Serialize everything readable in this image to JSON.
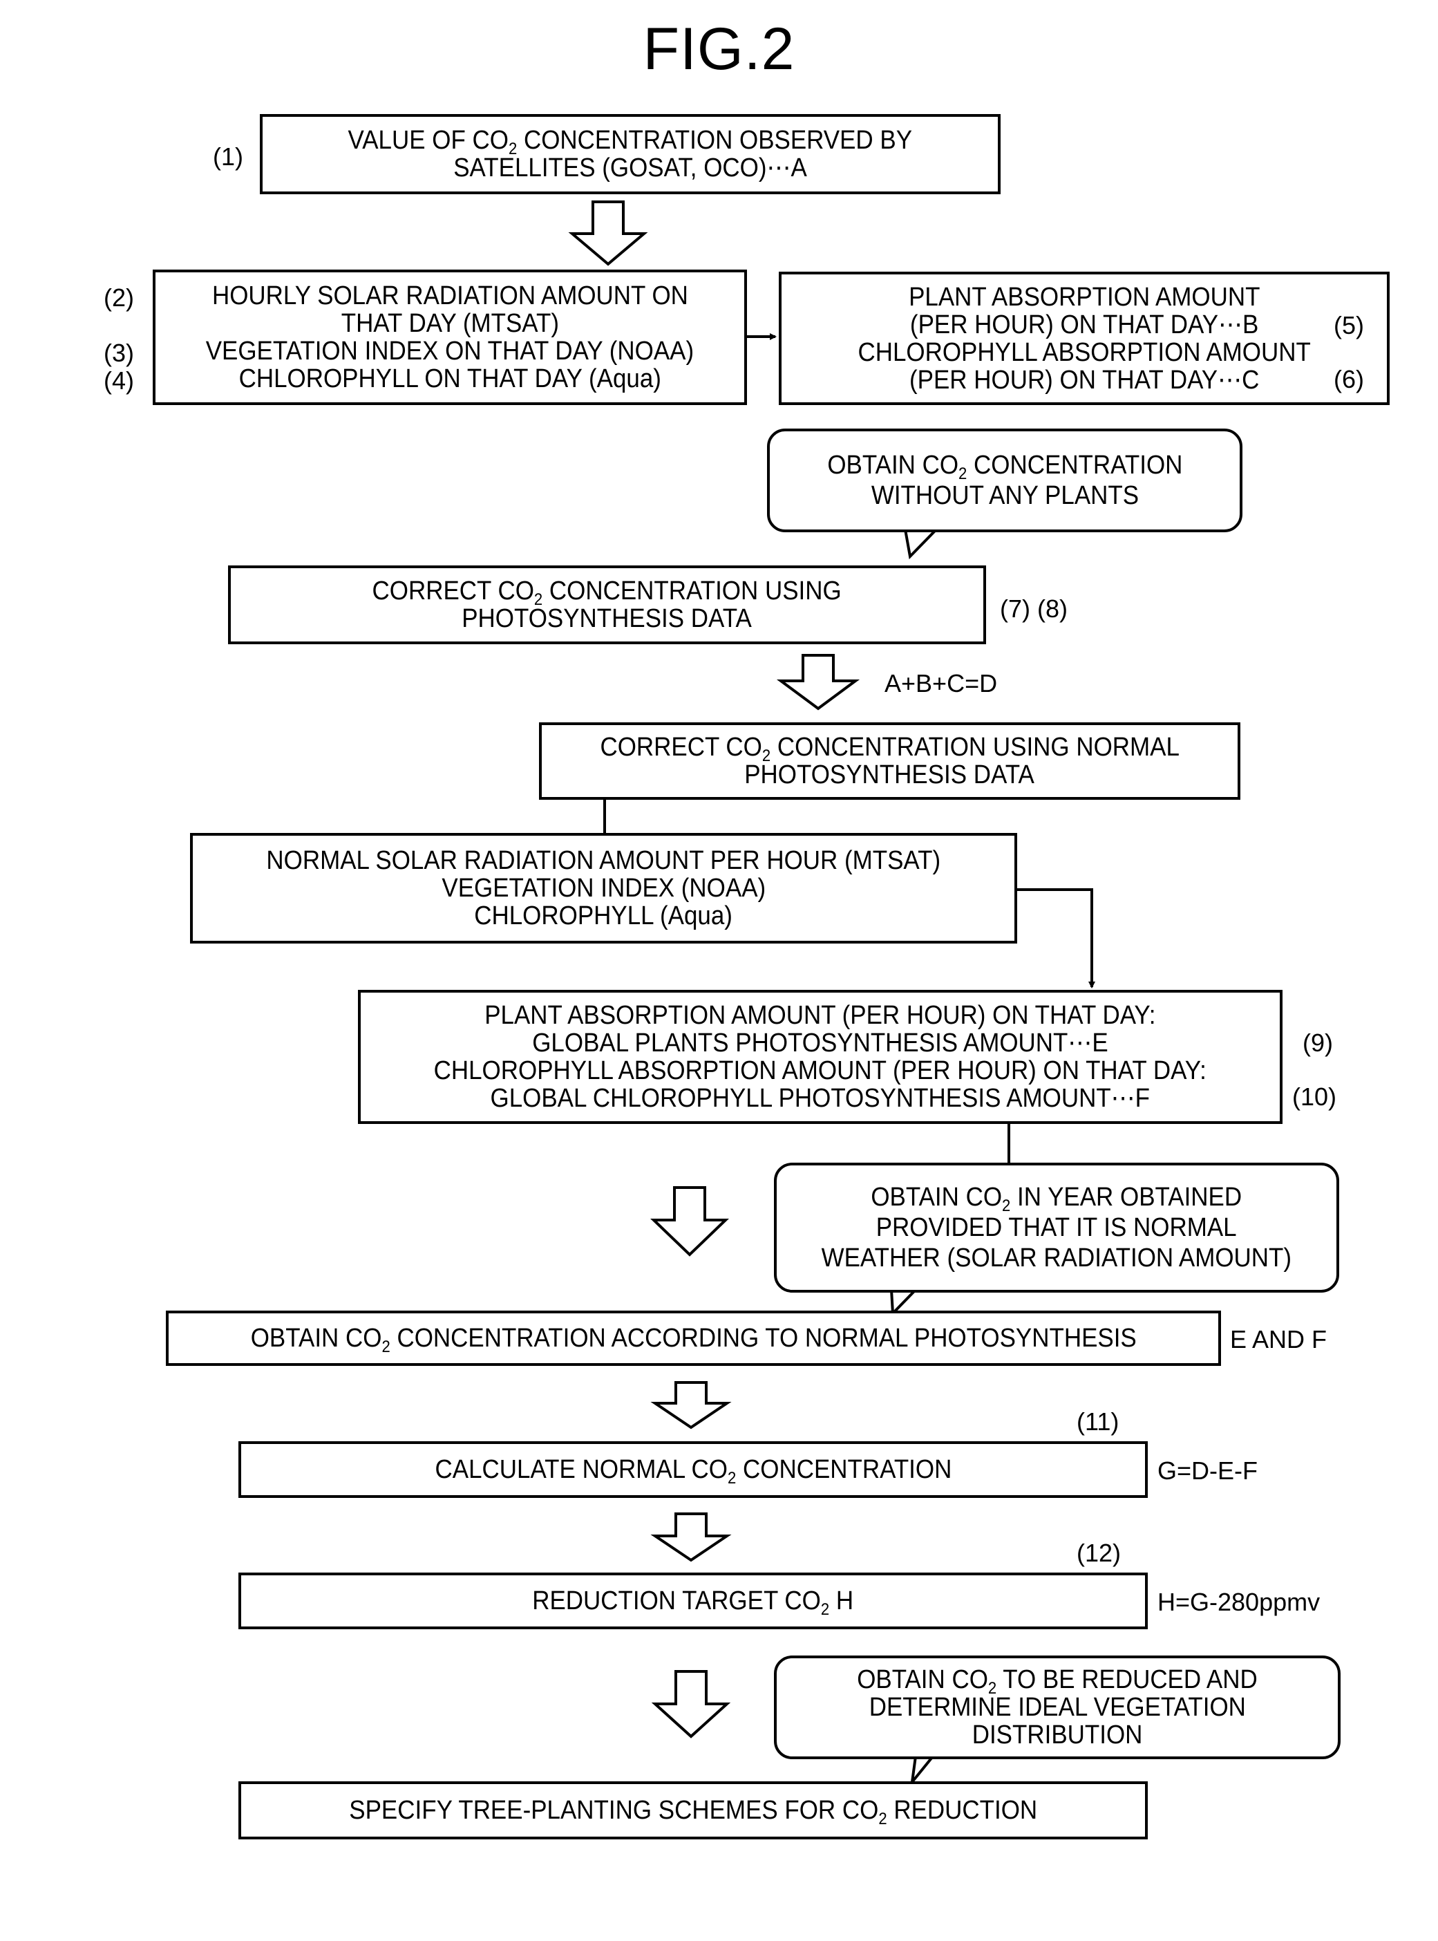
{
  "figure": {
    "title": "FIG.2"
  },
  "steps": {
    "observed": {
      "ref": "(1)",
      "lines": [
        "VALUE OF CO|2| CONCENTRATION OBSERVED BY",
        "SATELLITES (GOSAT, OCO)⋯A"
      ]
    },
    "inputs": {
      "refs": [
        "(2)",
        "(3)",
        "(4)"
      ],
      "lines": [
        "HOURLY SOLAR RADIATION AMOUNT ON",
        "THAT DAY (MTSAT)",
        "VEGETATION INDEX ON THAT DAY (NOAA)",
        "CHLOROPHYLL ON THAT DAY (Aqua)"
      ]
    },
    "absorption": {
      "refs": [
        "(5)",
        "(6)"
      ],
      "lines": [
        "PLANT ABSORPTION AMOUNT",
        "(PER HOUR) ON THAT DAY⋯B",
        "CHLOROPHYLL ABSORPTION AMOUNT",
        "(PER HOUR) ON THAT DAY⋯C"
      ]
    },
    "note_no_plants": {
      "lines": [
        "OBTAIN CO|2| CONCENTRATION",
        "WITHOUT ANY PLANTS"
      ]
    },
    "correct_photo": {
      "ref": "(7) (8)",
      "lines": [
        "CORRECT CO|2| CONCENTRATION USING",
        "PHOTOSYNTHESIS DATA"
      ],
      "formula": "A+B+C=D"
    },
    "correct_normal": {
      "lines": [
        "CORRECT CO|2| CONCENTRATION USING NORMAL",
        "PHOTOSYNTHESIS DATA"
      ]
    },
    "normal_inputs": {
      "lines": [
        "NORMAL SOLAR RADIATION AMOUNT PER HOUR (MTSAT)",
        "VEGETATION INDEX (NOAA)",
        "CHLOROPHYLL (Aqua)"
      ]
    },
    "global_amounts": {
      "refs": [
        "(9)",
        "(10)"
      ],
      "lines": [
        "PLANT ABSORPTION AMOUNT (PER HOUR) ON THAT DAY:",
        "GLOBAL PLANTS PHOTOSYNTHESIS AMOUNT⋯E",
        "CHLOROPHYLL ABSORPTION AMOUNT (PER HOUR) ON THAT DAY:",
        "GLOBAL CHLOROPHYLL PHOTOSYNTHESIS AMOUNT⋯F"
      ]
    },
    "note_normal_weather": {
      "lines": [
        "OBTAIN CO|2| IN YEAR OBTAINED",
        "PROVIDED THAT IT IS NORMAL",
        "WEATHER (SOLAR RADIATION AMOUNT)"
      ]
    },
    "obtain_normal": {
      "lines": [
        "OBTAIN CO|2| CONCENTRATION ACCORDING TO NORMAL PHOTOSYNTHESIS"
      ],
      "side": "E AND F"
    },
    "calc_normal": {
      "ref": "(11)",
      "lines": [
        "CALCULATE NORMAL CO|2| CONCENTRATION"
      ],
      "formula": "G=D-E-F"
    },
    "reduction_target": {
      "ref": "(12)",
      "lines": [
        "REDUCTION TARGET CO|2| H"
      ],
      "formula": "H=G-280ppmv"
    },
    "note_ideal_veg": {
      "lines": [
        "OBTAIN CO|2| TO BE REDUCED AND",
        "DETERMINE IDEAL VEGETATION",
        "DISTRIBUTION"
      ]
    },
    "tree_planting": {
      "lines": [
        "SPECIFY TREE-PLANTING SCHEMES FOR CO|2| REDUCTION"
      ]
    }
  }
}
